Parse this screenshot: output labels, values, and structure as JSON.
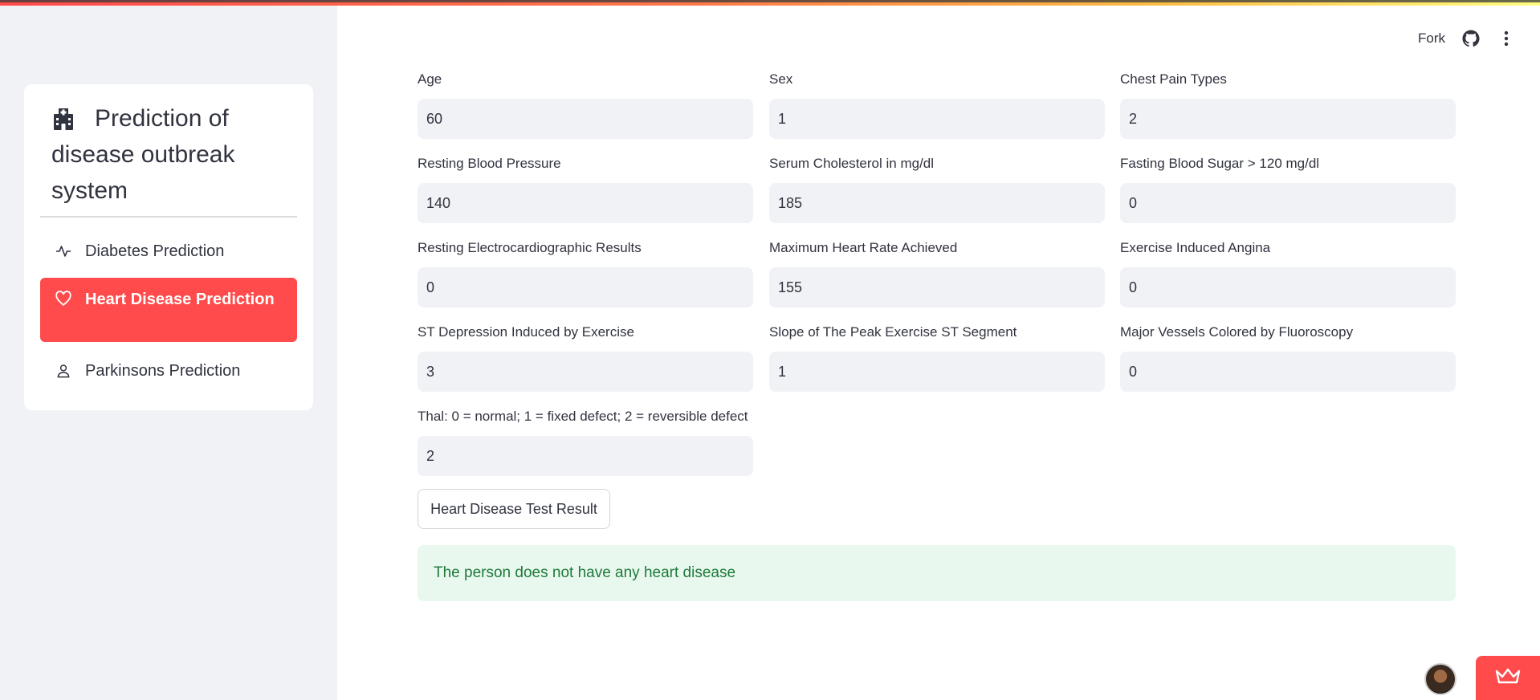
{
  "header": {
    "fork_label": "Fork"
  },
  "sidebar": {
    "title": "Prediction of disease outbreak system",
    "items": [
      {
        "label": "Diabetes Prediction",
        "icon": "activity-icon",
        "active": false
      },
      {
        "label": "Heart Disease Prediction",
        "icon": "heart-icon",
        "active": true
      },
      {
        "label": "Parkinsons Prediction",
        "icon": "person-icon",
        "active": false
      }
    ]
  },
  "form": {
    "fields": [
      {
        "label": "Age",
        "value": "60"
      },
      {
        "label": "Sex",
        "value": "1"
      },
      {
        "label": "Chest Pain Types",
        "value": "2"
      },
      {
        "label": "Resting Blood Pressure",
        "value": "140"
      },
      {
        "label": "Serum Cholesterol in mg/dl",
        "value": "185"
      },
      {
        "label": "Fasting Blood Sugar > 120 mg/dl",
        "value": "0"
      },
      {
        "label": "Resting Electrocardiographic Results",
        "value": "0"
      },
      {
        "label": "Maximum Heart Rate Achieved",
        "value": "155"
      },
      {
        "label": "Exercise Induced Angina",
        "value": "0"
      },
      {
        "label": "ST Depression Induced by Exercise",
        "value": "3"
      },
      {
        "label": "Slope of The Peak Exercise ST Segment",
        "value": "1"
      },
      {
        "label": "Major Vessels Colored by Fluoroscopy",
        "value": "0"
      },
      {
        "label": "Thal: 0 = normal; 1 = fixed defect; 2 = reversible defect",
        "value": "2"
      }
    ],
    "submit_label": "Heart Disease Test Result"
  },
  "result": {
    "message": "The person does not have any heart disease"
  },
  "colors": {
    "accent": "#ff4b4b",
    "success_bg": "#e8f8ee",
    "success_text": "#1f7a3a",
    "sidebar_bg": "#f0f2f6"
  }
}
